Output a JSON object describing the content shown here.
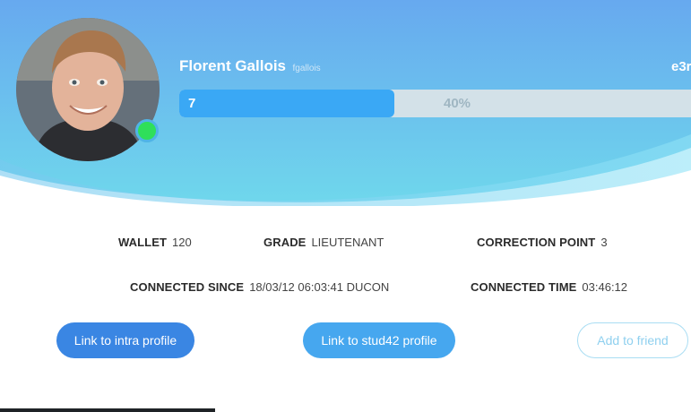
{
  "profile": {
    "name": "Florent Gallois",
    "login": "fgallois",
    "tag": "e3r",
    "level": "7",
    "level_percent": "40%",
    "level_progress": 0.4,
    "online": true
  },
  "stats": {
    "wallet_label": "WALLET",
    "wallet_value": "120",
    "grade_label": "GRADE",
    "grade_value": "LIEUTENANT",
    "correction_label": "CORRECTION POINT",
    "correction_value": "3",
    "connected_since_label": "CONNECTED SINCE",
    "connected_since_value": "18/03/12 06:03:41 DUCON",
    "connected_time_label": "CONNECTED TIME",
    "connected_time_value": "03:46:12"
  },
  "actions": {
    "intra": "Link to intra profile",
    "stud42": "Link to stud42 profile",
    "friend": "Add to friend"
  },
  "colors": {
    "header_gradient_top": "#6aaeee",
    "header_gradient_bottom": "#6ed6ec",
    "progress_fill": "#3aa8f5",
    "online": "#2fdf5a",
    "primary_button": "#3a86e3",
    "secondary_button": "#46a7ef"
  }
}
